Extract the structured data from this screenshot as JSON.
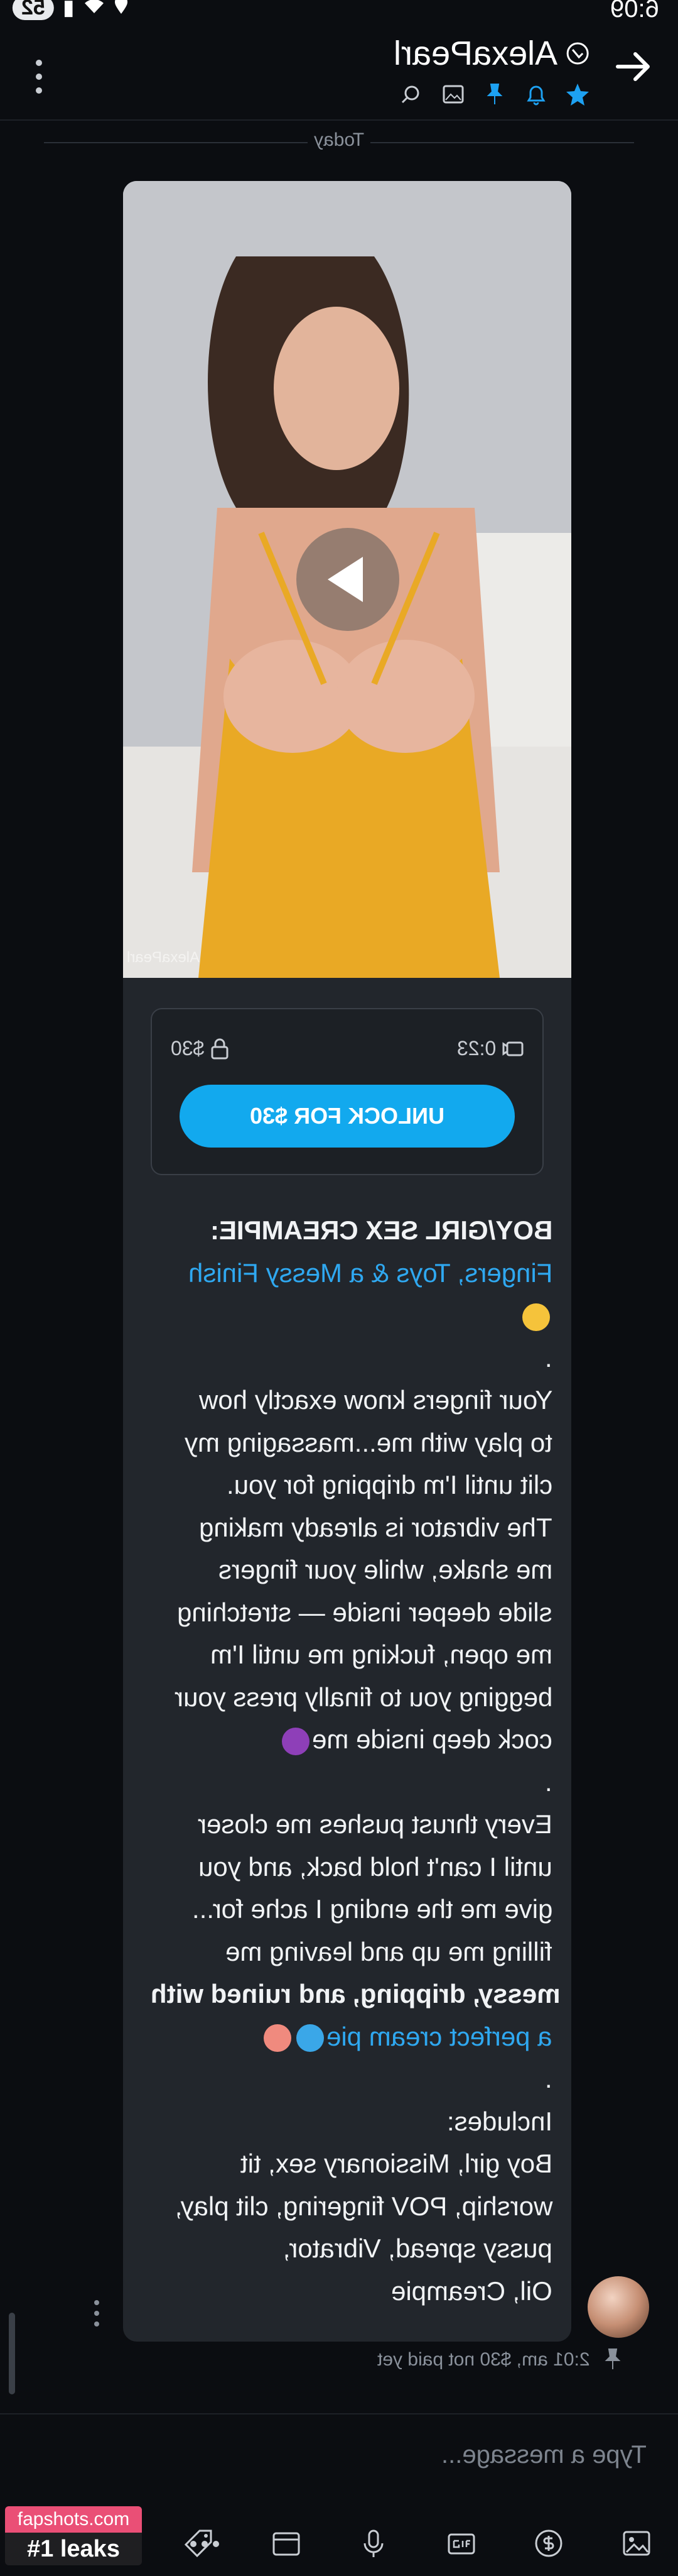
{
  "status_bar": {
    "time": "6:09",
    "notification_count": "52"
  },
  "header": {
    "title": "AlexaPearl"
  },
  "day_divider": "Today",
  "message": {
    "media": {
      "watermark": "AlexaPearl"
    },
    "locked": {
      "duration": "0:23",
      "price": "$30",
      "unlock_label": "UNLOCK FOR $30"
    },
    "lines": [
      "BOY/GIRL SEX CREAMPIE:",
      "Fingers, Toys & a Messy Finish",
      ".",
      "Your fingers know exactly how",
      "to play with me...massaging my",
      "clit until I'm dripping for you.",
      "The vibrator is already making",
      "me shake, while your fingers",
      "slide deeper inside — stretching",
      "me open, fucking me until I'm",
      "begging you to finally press your",
      "cock deep inside me",
      ".",
      "Every thrust pushes me closer",
      "until I can't hold back, and you",
      "give me the ending I ache for...",
      "filling me up and leaving me",
      "messy, dripping, and ruined with",
      "a perfect cream pie",
      ".",
      "Includes:",
      "Boy girl, Missionary sex, tit",
      "worship, POV fingering, clit play,",
      "pussy spread, Vibrator,",
      "Oil, Creampie"
    ],
    "meta": "2:01 am, $30 not paid yet"
  },
  "composer": {
    "placeholder": "Type a message..."
  },
  "watermark_badge": {
    "site": "fapshots.com",
    "tag": "#1 leaks"
  },
  "colors": {
    "accent": "#12a9ee",
    "link": "#2fa8f0",
    "bubble": "#22262c",
    "background": "#0b0d11"
  }
}
